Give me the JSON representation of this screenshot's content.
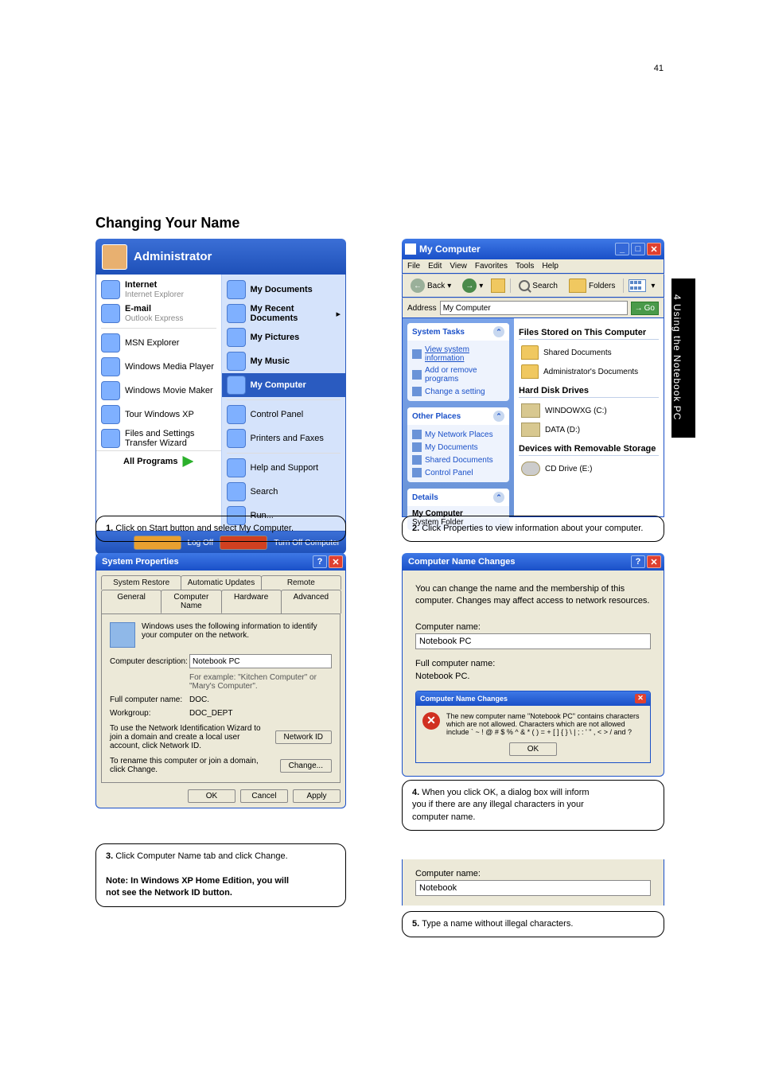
{
  "page_number": "41",
  "side_tab": "4  Using the Notebook PC",
  "section_title": "Changing Your Name",
  "caption1": "Click on Start button and select My Computer.",
  "caption2": "Click Properties to view information about your computer.",
  "caption3a": "Click Computer Name tab and click Change.",
  "caption3b": "Note: In Windows XP Home Edition, you will\nnot see the Network ID button.",
  "caption4": "When you click OK, a dialog box will inform\nyou if there are any illegal characters in your\ncomputer name.",
  "caption5": "Type a name without illegal characters.",
  "start_menu": {
    "user": "Administrator",
    "left": [
      {
        "name": "internet",
        "title": "Internet",
        "sub": "Internet Explorer"
      },
      {
        "name": "email",
        "title": "E-mail",
        "sub": "Outlook Express"
      },
      {
        "name": "msn",
        "title": "MSN Explorer",
        "sub": ""
      },
      {
        "name": "wmp",
        "title": "Windows Media Player",
        "sub": ""
      },
      {
        "name": "wmm",
        "title": "Windows Movie Maker",
        "sub": ""
      },
      {
        "name": "tour",
        "title": "Tour Windows XP",
        "sub": ""
      },
      {
        "name": "fst",
        "title": "Files and Settings Transfer Wizard",
        "sub": ""
      }
    ],
    "all_programs": "All Programs",
    "right": [
      {
        "name": "mydocs",
        "title": "My Documents",
        "bold": true
      },
      {
        "name": "myrecent",
        "title": "My Recent Documents",
        "bold": true,
        "arrow": true
      },
      {
        "name": "mypics",
        "title": "My Pictures",
        "bold": true
      },
      {
        "name": "mymusic",
        "title": "My Music",
        "bold": true
      },
      {
        "name": "mycomp",
        "title": "My Computer",
        "bold": true,
        "highlight": true
      },
      {
        "name": "cpanel",
        "title": "Control Panel",
        "bold": false
      },
      {
        "name": "printers",
        "title": "Printers and Faxes",
        "bold": false
      },
      {
        "name": "help",
        "title": "Help and Support",
        "bold": false
      },
      {
        "name": "search",
        "title": "Search",
        "bold": false
      },
      {
        "name": "run",
        "title": "Run...",
        "bold": false
      }
    ],
    "logoff": "Log Off",
    "turnoff": "Turn Off Computer"
  },
  "my_computer": {
    "title": "My Computer",
    "menus": [
      "File",
      "Edit",
      "View",
      "Favorites",
      "Tools",
      "Help"
    ],
    "back": "Back",
    "search": "Search",
    "folders": "Folders",
    "address_label": "Address",
    "address_value": "My Computer",
    "go": "Go",
    "system_tasks": {
      "title": "System Tasks",
      "links": [
        "View system information",
        "Add or remove programs",
        "Change a setting"
      ]
    },
    "other_places": {
      "title": "Other Places",
      "links": [
        "My Network Places",
        "My Documents",
        "Shared Documents",
        "Control Panel"
      ]
    },
    "details": {
      "title": "Details",
      "name": "My Computer",
      "type": "System Folder"
    },
    "groups": [
      {
        "header": "Files Stored on This Computer",
        "items": [
          "Shared Documents",
          "Administrator's Documents"
        ]
      },
      {
        "header": "Hard Disk Drives",
        "items": [
          "WINDOWXG (C:)",
          "DATA (D:)"
        ]
      },
      {
        "header": "Devices with Removable Storage",
        "items": [
          "CD Drive (E:)"
        ]
      }
    ]
  },
  "sys_props": {
    "title": "System Properties",
    "tabs_back": [
      "System Restore",
      "Automatic Updates",
      "Remote"
    ],
    "tabs_front": [
      "General",
      "Computer Name",
      "Hardware",
      "Advanced"
    ],
    "active_tab": "Computer Name",
    "intro": "Windows uses the following information to identify your computer on the network.",
    "desc_label": "Computer description:",
    "desc_value": "Notebook PC",
    "desc_hint": "For example: \"Kitchen Computer\" or \"Mary's Computer\".",
    "full_label": "Full computer name:",
    "full_value": "DOC.",
    "wg_label": "Workgroup:",
    "wg_value": "DOC_DEPT",
    "netid_text": "To use the Network Identification Wizard to join a domain and create a local user account, click Network ID.",
    "netid_btn": "Network ID",
    "change_text": "To rename this computer or join a domain, click Change.",
    "change_btn": "Change...",
    "ok": "OK",
    "cancel": "Cancel",
    "apply": "Apply"
  },
  "cnc": {
    "title": "Computer Name Changes",
    "desc": "You can change the name and the membership of this computer. Changes may affect access to network resources.",
    "name_label": "Computer name:",
    "name_value": "Notebook PC",
    "full_label": "Full computer name:",
    "full_value": "Notebook PC.",
    "error": {
      "title": "Computer Name Changes",
      "msg": "The new computer name \"Notebook PC\" contains characters which are not allowed. Characters which are not allowed include ` ~ ! @ # $ % ^ & * ( ) = + [ ] { } \\ | ; : ' \" , < > / and ?",
      "ok": "OK"
    }
  },
  "cnc2": {
    "name_label": "Computer name:",
    "name_value": "Notebook"
  }
}
